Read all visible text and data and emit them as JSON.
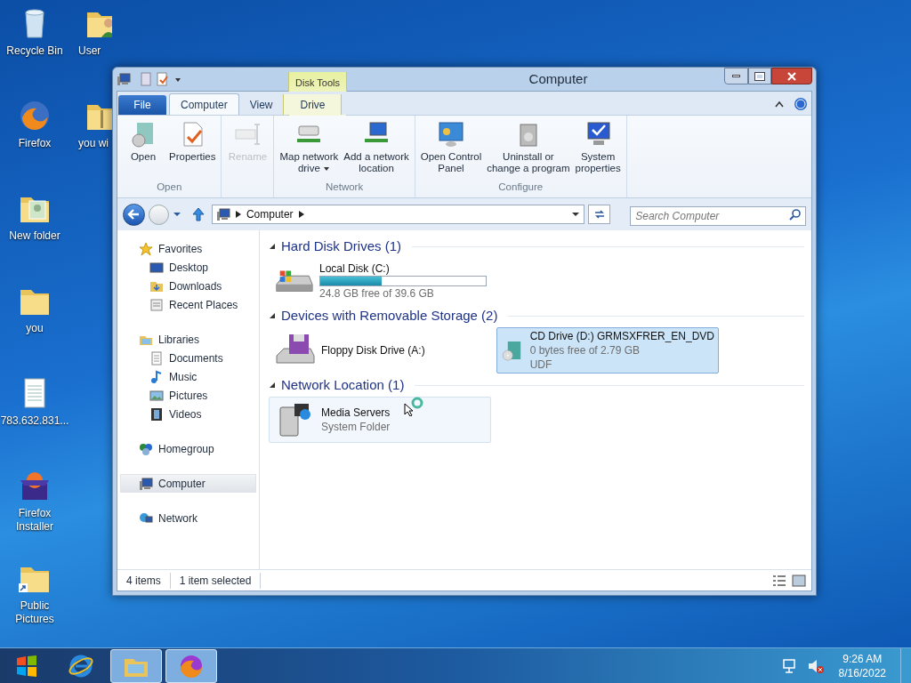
{
  "desktop_icons": [
    {
      "label": "Recycle Bin",
      "kind": "recycle"
    },
    {
      "label": "User",
      "kind": "user-folder"
    },
    {
      "label": "Firefox",
      "kind": "firefox"
    },
    {
      "label": "you wi",
      "kind": "zip-folder"
    },
    {
      "label": "New folder",
      "kind": "photo-folder"
    },
    {
      "label": "you",
      "kind": "folder"
    },
    {
      "label": "783.632.831...",
      "kind": "document"
    },
    {
      "label": "Firefox Installer",
      "kind": "installer"
    },
    {
      "label": "Public Pictures",
      "kind": "folder-shortcut"
    }
  ],
  "window": {
    "title": "Computer",
    "context_header": "Disk Tools"
  },
  "ribbon": {
    "tabs": [
      {
        "label": "File",
        "kind": "file",
        "selected": false
      },
      {
        "label": "Computer",
        "kind": "tab",
        "selected": true
      },
      {
        "label": "View",
        "kind": "tab",
        "selected": false
      },
      {
        "label": "Drive",
        "kind": "context",
        "selected": false
      }
    ],
    "groups": [
      {
        "label": "Open",
        "buttons": [
          {
            "label": "Open",
            "kind": "open",
            "disabled": false,
            "dropdown": false
          },
          {
            "label": "Properties",
            "kind": "properties",
            "disabled": false,
            "dropdown": false
          }
        ]
      },
      {
        "buttons": [
          {
            "label": "Rename",
            "kind": "rename",
            "disabled": true,
            "dropdown": false
          }
        ]
      },
      {
        "label": "Network",
        "buttons": [
          {
            "label": "Map network\ndrive",
            "kind": "map-drive",
            "disabled": false,
            "dropdown": true
          },
          {
            "label": "Add a network\nlocation",
            "kind": "add-location",
            "disabled": false,
            "dropdown": false
          }
        ]
      },
      {
        "label": "Configure",
        "buttons": [
          {
            "label": "Open Control\nPanel",
            "kind": "control-panel",
            "disabled": false,
            "dropdown": false
          },
          {
            "label": "Uninstall or\nchange a program",
            "kind": "uninstall",
            "disabled": false,
            "dropdown": false
          },
          {
            "label": "System\nproperties",
            "kind": "system",
            "disabled": false,
            "dropdown": false
          }
        ]
      }
    ]
  },
  "address": {
    "segments": [
      "Computer"
    ]
  },
  "search": {
    "placeholder": "Search Computer"
  },
  "nav_pane": [
    {
      "label": "Favorites",
      "kind": "star",
      "selected": false,
      "children": [
        {
          "label": "Desktop",
          "kind": "desktop",
          "selected": false
        },
        {
          "label": "Downloads",
          "kind": "downloads",
          "selected": false
        },
        {
          "label": "Recent Places",
          "kind": "recent",
          "selected": false
        }
      ]
    },
    {
      "label": "Libraries",
      "kind": "libraries",
      "selected": false,
      "children": [
        {
          "label": "Documents",
          "kind": "documents",
          "selected": false
        },
        {
          "label": "Music",
          "kind": "music",
          "selected": false
        },
        {
          "label": "Pictures",
          "kind": "pictures",
          "selected": false
        },
        {
          "label": "Videos",
          "kind": "videos",
          "selected": false
        }
      ]
    },
    {
      "label": "Homegroup",
      "kind": "homegroup",
      "selected": false
    },
    {
      "label": "Computer",
      "kind": "computer",
      "selected": true
    },
    {
      "label": "Network",
      "kind": "network",
      "selected": false
    }
  ],
  "sections": [
    {
      "title": "Hard Disk Drives (1)",
      "expanded": true,
      "items": [
        {
          "name": "Local Disk (C:)",
          "kind": "hard-disk",
          "level": 0.37,
          "details": [
            "24.8 GB free of 39.6 GB"
          ],
          "selected": false,
          "hot": false
        }
      ]
    },
    {
      "title": "Devices with Removable Storage (2)",
      "expanded": true,
      "items": [
        {
          "name": "Floppy Disk Drive (A:)",
          "kind": "floppy",
          "selected": false,
          "hot": false
        },
        {
          "name": "CD Drive (D:) GRMSXFRER_EN_DVD",
          "kind": "cd",
          "details": [
            "0 bytes free of 2.79 GB",
            "UDF"
          ],
          "selected": true,
          "hot": false
        }
      ]
    },
    {
      "title": "Network Location (1)",
      "expanded": true,
      "items": [
        {
          "name": "Media Servers",
          "kind": "media-server",
          "details": [
            "System Folder"
          ],
          "selected": false,
          "hot": true
        }
      ]
    }
  ],
  "status_bar": [
    "4 items",
    "1 item selected"
  ],
  "taskbar": {
    "buttons": [
      {
        "kind": "start",
        "active": false
      },
      {
        "kind": "ie",
        "active": false
      },
      {
        "kind": "explorer",
        "active": true
      },
      {
        "kind": "firefox",
        "active": true
      }
    ],
    "time": "9:26 AM",
    "date": "8/16/2022"
  }
}
